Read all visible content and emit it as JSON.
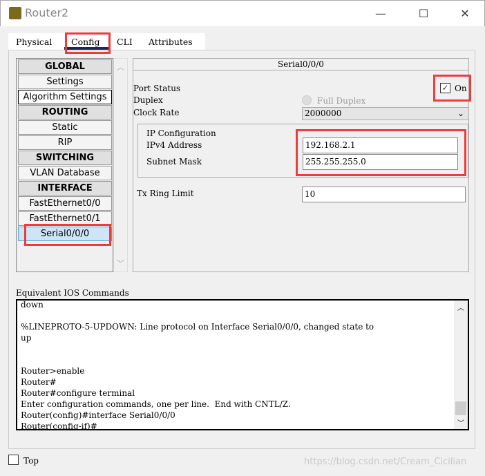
{
  "window": {
    "title": "Router2",
    "minimize": "—",
    "maximize": "☐",
    "close": "✕"
  },
  "tabs": [
    {
      "label": "Physical"
    },
    {
      "label": "Config",
      "active": true
    },
    {
      "label": "CLI"
    },
    {
      "label": "Attributes"
    }
  ],
  "sidebar": {
    "items": [
      {
        "label": "GLOBAL",
        "type": "header"
      },
      {
        "label": "Settings"
      },
      {
        "label": "Algorithm Settings"
      },
      {
        "label": "ROUTING",
        "type": "header"
      },
      {
        "label": "Static"
      },
      {
        "label": "RIP"
      },
      {
        "label": "SWITCHING",
        "type": "header"
      },
      {
        "label": "VLAN Database"
      },
      {
        "label": "INTERFACE",
        "type": "header"
      },
      {
        "label": "FastEthernet0/0"
      },
      {
        "label": "FastEthernet0/1"
      },
      {
        "label": "Serial0/0/0",
        "selected": true
      }
    ]
  },
  "interface": {
    "title": "Serial0/0/0",
    "port_status_label": "Port Status",
    "port_status_on": true,
    "on_label": "On",
    "duplex_label": "Duplex",
    "duplex_value": "Full Duplex",
    "clock_rate_label": "Clock Rate",
    "clock_rate_value": "2000000",
    "ip_config_label": "IP Configuration",
    "ipv4_label": "IPv4 Address",
    "ipv4_value": "192.168.2.1",
    "mask_label": "Subnet Mask",
    "mask_value": "255.255.255.0",
    "tx_label": "Tx Ring Limit",
    "tx_value": "10"
  },
  "console": {
    "label": "Equivalent IOS Commands",
    "lines": [
      "down",
      "",
      "%LINEPROTO-5-UPDOWN: Line protocol on Interface Serial0/0/0, changed state to",
      "up",
      "",
      "",
      "Router>enable",
      "Router#",
      "Router#configure terminal",
      "Enter configuration commands, one per line.  End with CNTL/Z.",
      "Router(config)#interface Serial0/0/0",
      "Router(config-if)#"
    ]
  },
  "footer": {
    "top_label": "Top",
    "top_checked": false,
    "watermark": "https://blog.csdn.net/Cream_Cicilian"
  },
  "colors": {
    "highlight": "#f03b3b",
    "selected": "#cde6f7"
  }
}
